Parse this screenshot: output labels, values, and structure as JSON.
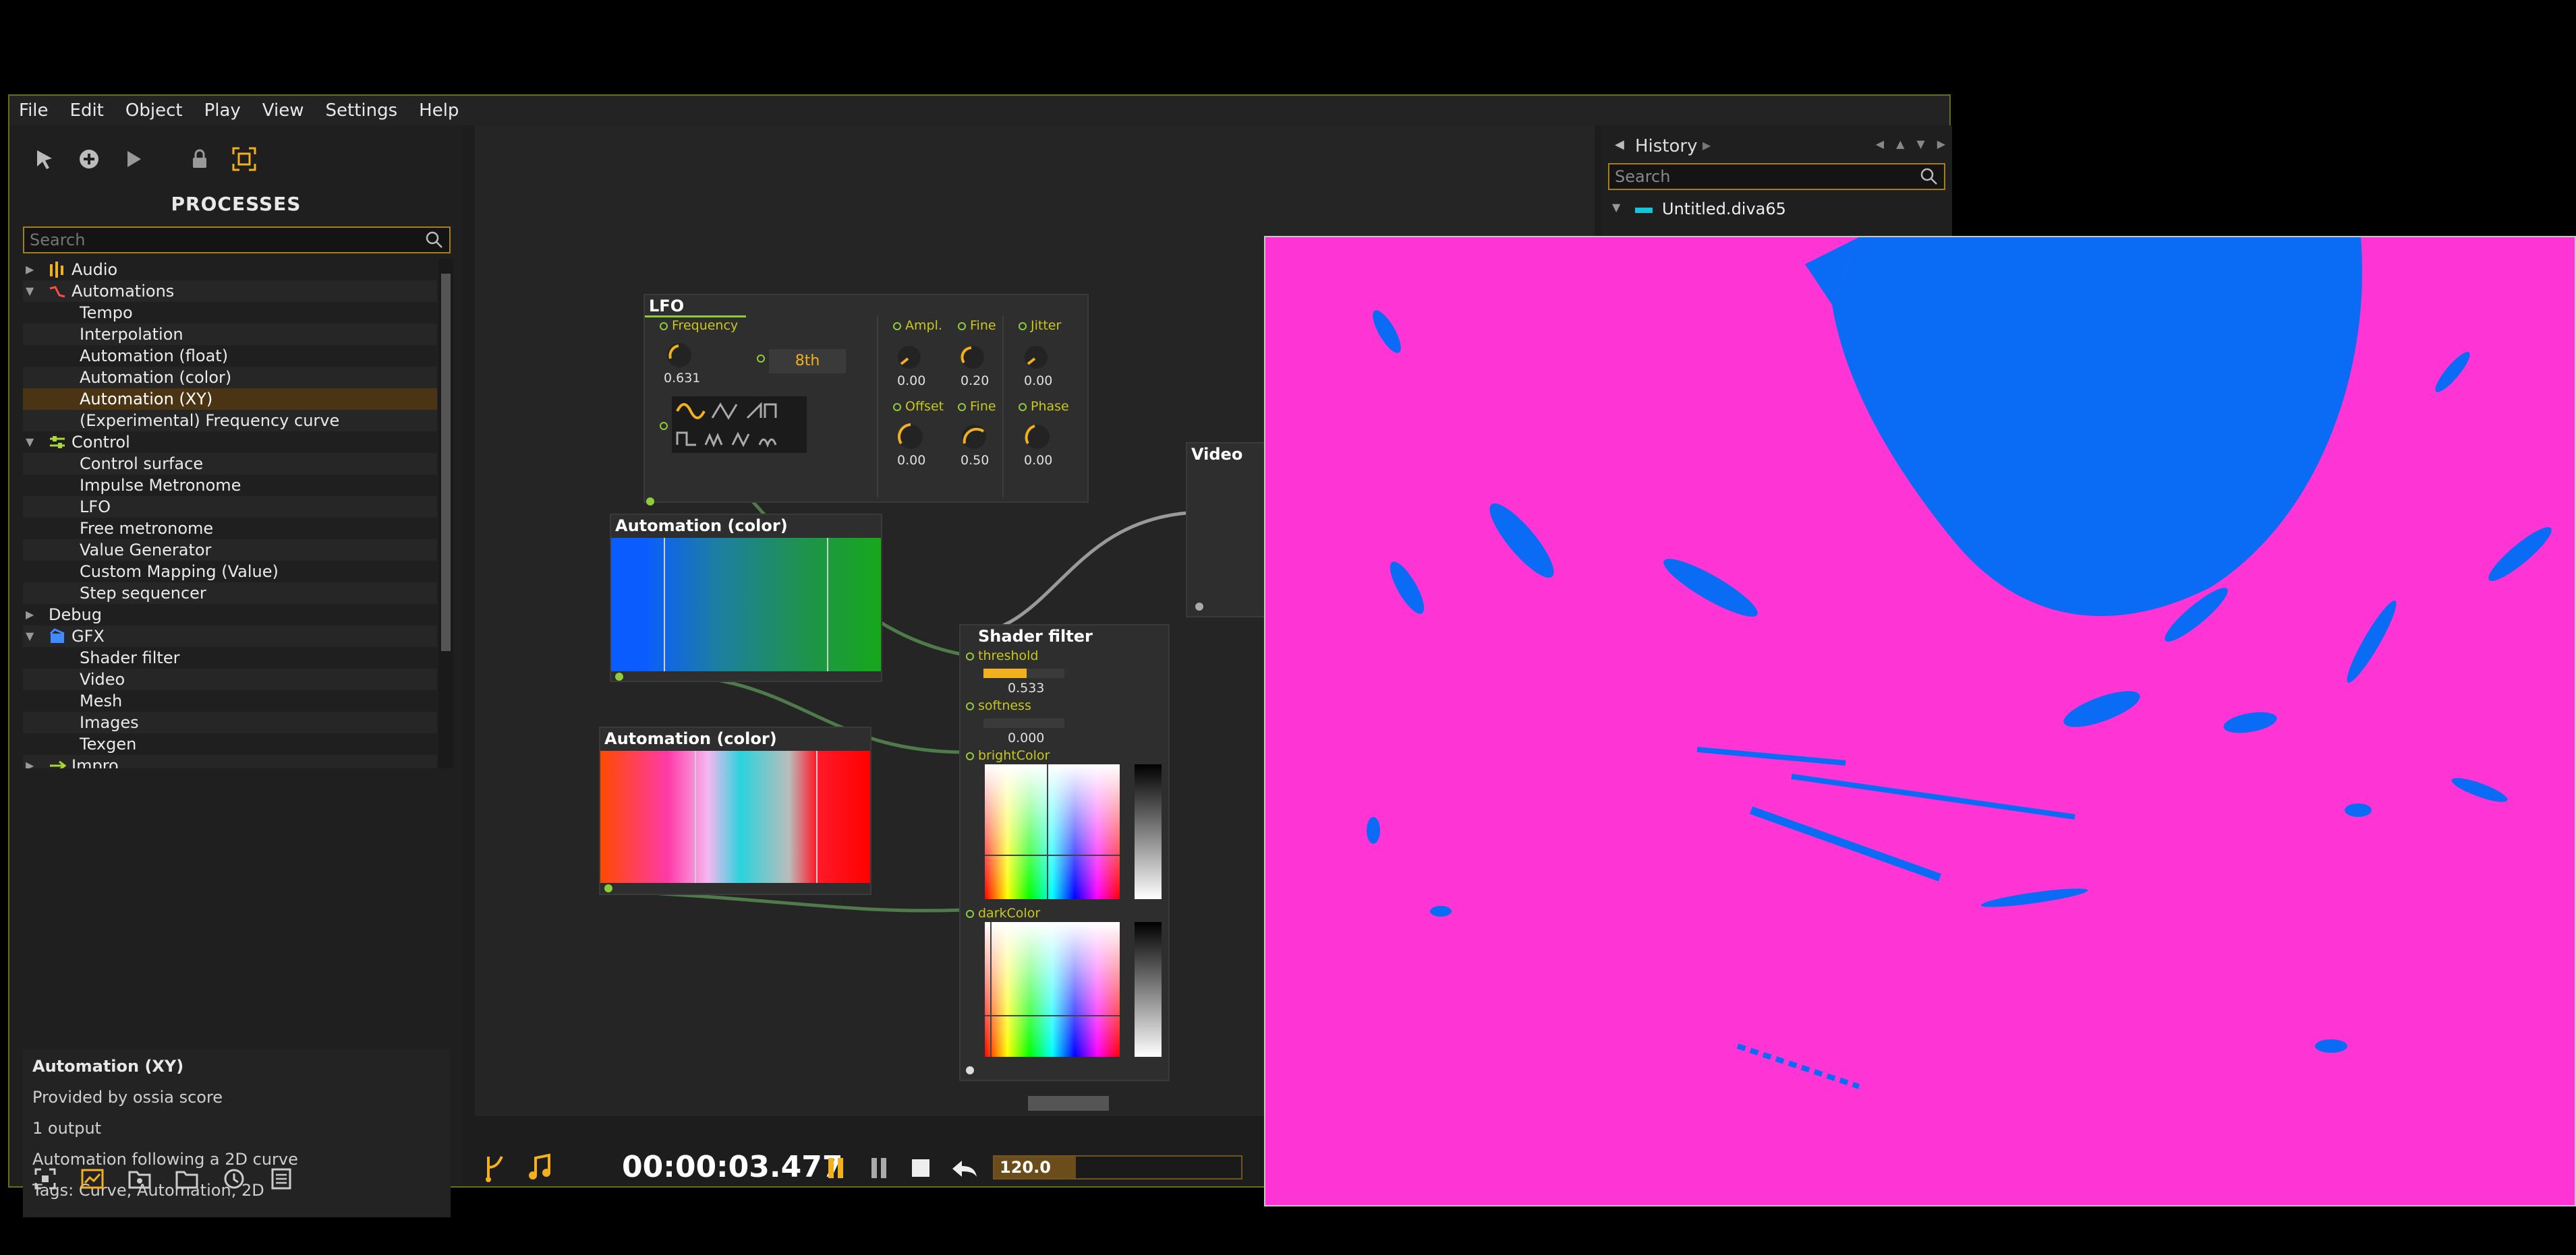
{
  "menu": [
    "File",
    "Edit",
    "Object",
    "Play",
    "View",
    "Settings",
    "Help"
  ],
  "processes": {
    "title": "PROCESSES",
    "search_placeholder": "Search",
    "tree": [
      {
        "label": "Audio",
        "level": "top",
        "arrow": "▶",
        "icon": "audio-icon"
      },
      {
        "label": "Automations",
        "level": "top",
        "arrow": "▼",
        "icon": "automation-icon"
      },
      {
        "label": "Tempo",
        "level": "child"
      },
      {
        "label": "Interpolation",
        "level": "child"
      },
      {
        "label": "Automation (float)",
        "level": "child"
      },
      {
        "label": "Automation (color)",
        "level": "child"
      },
      {
        "label": "Automation (XY)",
        "level": "child",
        "selected": true
      },
      {
        "label": "(Experimental) Frequency curve",
        "level": "child"
      },
      {
        "label": "Control",
        "level": "top",
        "arrow": "▼",
        "icon": "control-icon"
      },
      {
        "label": "Control surface",
        "level": "child"
      },
      {
        "label": "Impulse Metronome",
        "level": "child"
      },
      {
        "label": "LFO",
        "level": "child"
      },
      {
        "label": "Free metronome",
        "level": "child"
      },
      {
        "label": "Value Generator",
        "level": "child"
      },
      {
        "label": "Custom Mapping (Value)",
        "level": "child"
      },
      {
        "label": "Step sequencer",
        "level": "child"
      },
      {
        "label": "Debug",
        "level": "top",
        "arrow": "▶",
        "icon": ""
      },
      {
        "label": "GFX",
        "level": "top",
        "arrow": "▼",
        "icon": "gfx-icon"
      },
      {
        "label": "Shader filter",
        "level": "child"
      },
      {
        "label": "Video",
        "level": "child"
      },
      {
        "label": "Mesh",
        "level": "child"
      },
      {
        "label": "Images",
        "level": "child"
      },
      {
        "label": "Texgen",
        "level": "child"
      },
      {
        "label": "Impro",
        "level": "top",
        "arrow": "▶",
        "icon": "impro-icon"
      }
    ]
  },
  "info": {
    "title": "Automation (XY)",
    "provider": "Provided by ossia score",
    "outputs": "1 output",
    "description": "Automation following a 2D curve",
    "tags": "Tags: Curve, Automation, 2D"
  },
  "history": {
    "title": "History",
    "search_placeholder": "Search",
    "item": "Untitled.diva65"
  },
  "lfo": {
    "title": "LFO",
    "frequency_label": "Frequency",
    "frequency_value": "0.631",
    "quant": "8th",
    "ampl_label": "Ampl.",
    "ampl_value": "0.00",
    "fine1_label": "Fine",
    "fine1_value": "0.20",
    "jitter_label": "Jitter",
    "jitter_value": "0.00",
    "offset_label": "Offset",
    "offset_value": "0.00",
    "fine2_label": "Fine",
    "fine2_value": "0.50",
    "phase_label": "Phase",
    "phase_value": "0.00"
  },
  "automation_color_1": {
    "title": "Automation (color)"
  },
  "automation_color_2": {
    "title": "Automation (color)"
  },
  "video_node": {
    "title": "Video"
  },
  "shader": {
    "title": "Shader filter",
    "threshold_label": "threshold",
    "threshold_value": "0.533",
    "softness_label": "softness",
    "softness_value": "0.000",
    "bright_label": "brightColor",
    "dark_label": "darkColor"
  },
  "transport": {
    "time": "00:00:03.477",
    "tempo": "120.0",
    "tempo_fraction": 0.33
  },
  "colors": {
    "accent": "#f2b01e",
    "port": "#8fcc3c",
    "video_bg": "#fe35d4",
    "video_fg": "#0a6cf5"
  }
}
